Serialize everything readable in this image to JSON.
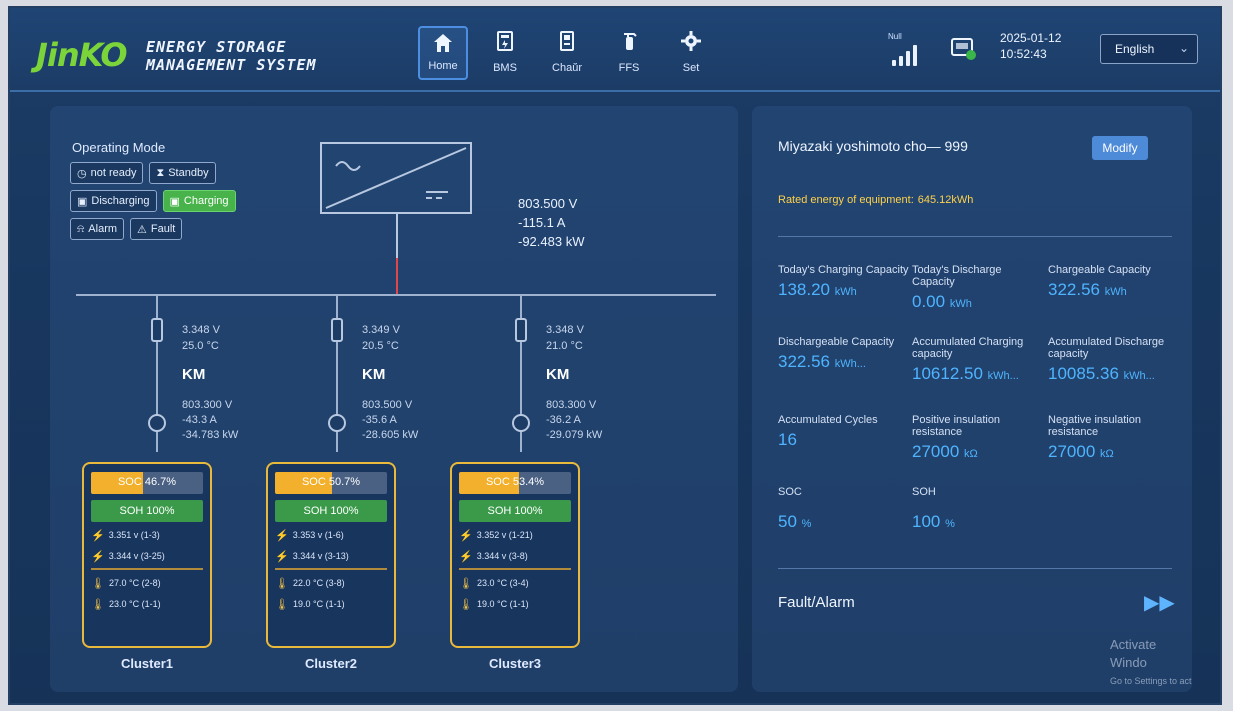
{
  "header": {
    "logo": "JinKO",
    "title_line1": "ENERGY STORAGE",
    "title_line2": "MANAGEMENT SYSTEM",
    "nav": [
      {
        "label": "Home",
        "icon": "home-icon",
        "active": true
      },
      {
        "label": "BMS",
        "icon": "battery-icon"
      },
      {
        "label": "Chaŭr",
        "icon": "charger-icon"
      },
      {
        "label": "FFS",
        "icon": "extinguisher-icon"
      },
      {
        "label": "Set",
        "icon": "gear-icon"
      }
    ],
    "signal_label": "Null",
    "date": "2025-01-12",
    "time": "10:52:43",
    "language": "English"
  },
  "operating": {
    "title": "Operating Mode",
    "modes_row1": [
      "not ready",
      "Standby"
    ],
    "modes_row2": [
      "Discharging",
      "Charging"
    ],
    "modes_row3": [
      "Alarm",
      "Fault"
    ],
    "active_mode": "Charging"
  },
  "pcs": {
    "voltage": "803.500 V",
    "current": "-115.1 A",
    "power": "-92.483 kW"
  },
  "branches": [
    {
      "v": "3.348 V",
      "t": "25.0 °C",
      "km": "KM",
      "bv": "803.300 V",
      "ba": "-43.3 A",
      "bp": "-34.783 kW"
    },
    {
      "v": "3.349 V",
      "t": "20.5 °C",
      "km": "KM",
      "bv": "803.500 V",
      "ba": "-35.6 A",
      "bp": "-28.605 kW"
    },
    {
      "v": "3.348 V",
      "t": "21.0 °C",
      "km": "KM",
      "bv": "803.300 V",
      "ba": "-36.2 A",
      "bp": "-29.079 kW"
    }
  ],
  "clusters": [
    {
      "name": "Cluster1",
      "soc_label": "SOC 46.7%",
      "soc": 46.7,
      "soh": "SOH 100%",
      "vmax": "3.351 v (1-3)",
      "vmin": "3.344 v (3-25)",
      "tmax": "27.0 °C (2-8)",
      "tmin": "23.0 °C (1-1)"
    },
    {
      "name": "Cluster2",
      "soc_label": "SOC 50.7%",
      "soc": 50.7,
      "soh": "SOH 100%",
      "vmax": "3.353 v (1-6)",
      "vmin": "3.344 v (3-13)",
      "tmax": "22.0 °C (3-8)",
      "tmin": "19.0 °C (1-1)"
    },
    {
      "name": "Cluster3",
      "soc_label": "SOC 53.4%",
      "soc": 53.4,
      "soh": "SOH 100%",
      "vmax": "3.352 v (1-21)",
      "vmin": "3.344 v (3-8)",
      "tmax": "23.0 °C (3-4)",
      "tmin": "19.0 °C (1-1)"
    }
  ],
  "right": {
    "site": "Miyazaki yoshimoto cho— 999",
    "modify": "Modify",
    "rated_label": "Rated energy of equipment:",
    "rated_value": "645.12kWh",
    "stats": [
      {
        "label": "Today's Charging Capacity",
        "value": "138.20",
        "unit": "kWh"
      },
      {
        "label": "Today's Discharge Capacity",
        "value": "0.00",
        "unit": "kWh"
      },
      {
        "label": "Chargeable Capacity",
        "value": "322.56",
        "unit": "kWh"
      },
      {
        "label": "Dischargeable Capacity",
        "value": "322.56",
        "unit": "kWh..."
      },
      {
        "label": "Accumulated Charging capacity",
        "value": "10612.50",
        "unit": "kWh..."
      },
      {
        "label": "Accumulated Discharge capacity",
        "value": "10085.36",
        "unit": "kWh..."
      },
      {
        "label": "Accumulated Cycles",
        "value": "16",
        "unit": ""
      },
      {
        "label": "Positive insulation resistance",
        "value": "27000",
        "unit": "kΩ"
      },
      {
        "label": "Negative insulation resistance",
        "value": "27000",
        "unit": "kΩ"
      }
    ],
    "soc_label": "SOC",
    "soc_value": "50",
    "soc_unit": "%",
    "soh_label": "SOH",
    "soh_value": "100",
    "soh_unit": "%",
    "fault_label": "Fault/Alarm",
    "fault_arrow": "▶▶",
    "activate_title": "Activate Windo",
    "activate_sub": "Go to Settings to act"
  },
  "colors": {
    "accent": "#4fb4ff",
    "charging": "#47b34a",
    "soc": "#f2b02c",
    "cluster_border": "#e8b93a",
    "rated": "#ffd24a"
  }
}
